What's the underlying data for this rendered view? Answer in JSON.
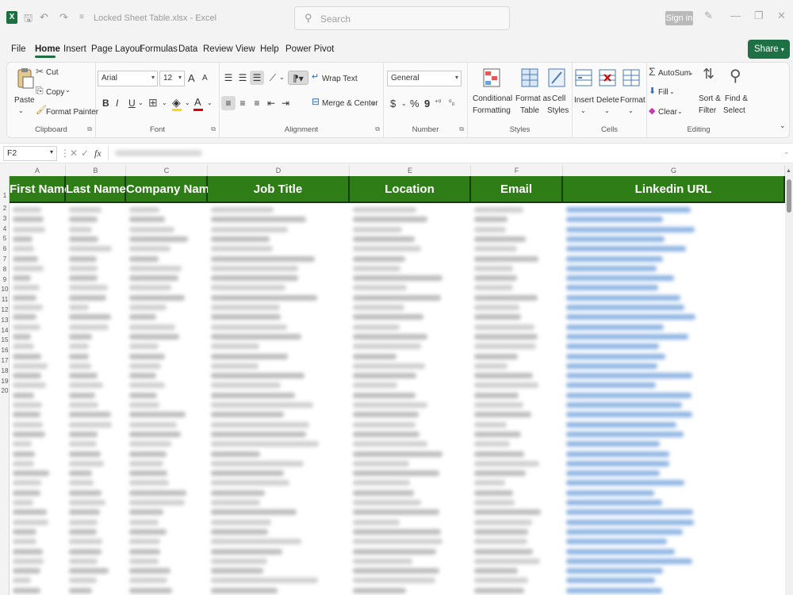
{
  "titlebar": {
    "app_badge": "X",
    "title": "Locked Sheet Table.xlsx  -  Excel",
    "search_placeholder": "Search",
    "signin": "Sign in"
  },
  "menu": {
    "tabs": [
      "File",
      "Home",
      "Insert",
      "Page Layout",
      "Formulas",
      "Data",
      "Review",
      "View",
      "Help",
      "Power Pivot"
    ],
    "active": "Home",
    "share": "Share"
  },
  "ribbon": {
    "clipboard": {
      "label": "Clipboard",
      "paste": "Paste",
      "cut": "Cut",
      "copy": "Copy",
      "format_painter": "Format Painter"
    },
    "font": {
      "label": "Font",
      "font_name": "Arial",
      "font_size": "12",
      "grow": "A",
      "shrink": "A",
      "bold": "B",
      "italic": "I",
      "underline": "U",
      "font_color": "A"
    },
    "alignment": {
      "label": "Alignment",
      "wrap_text": "Wrap Text",
      "merge_center": "Merge & Center"
    },
    "number": {
      "label": "Number",
      "format": "General",
      "currency": "$",
      "percent": "%",
      "comma": "9"
    },
    "styles": {
      "label": "Styles",
      "conditional_1": "Conditional",
      "conditional_2": "Formatting",
      "format_table_1": "Format as",
      "format_table_2": "Table",
      "cell_styles_1": "Cell",
      "cell_styles_2": "Styles"
    },
    "cells": {
      "label": "Cells",
      "insert": "Insert",
      "delete": "Delete",
      "format": "Format"
    },
    "editing": {
      "label": "Editing",
      "autosum": "AutoSum",
      "fill": "Fill",
      "clear": "Clear",
      "sort_1": "Sort &",
      "sort_2": "Filter",
      "find_1": "Find &",
      "find_2": "Select"
    }
  },
  "formula_bar": {
    "name_box": "F2",
    "fx": "fx"
  },
  "grid": {
    "columns": [
      "A",
      "B",
      "C",
      "D",
      "E",
      "F",
      "G"
    ],
    "headers": [
      "First Name",
      "Last Name",
      "Company Name",
      "Job Title",
      "Location",
      "Email",
      "Linkedin URL"
    ],
    "header_bg": "#2e7d16",
    "link_color": "#8fb4e3",
    "row_numbers": [
      "1",
      "2",
      "3",
      "4",
      "5",
      "6",
      "7",
      "8",
      "9",
      "10",
      "11",
      "12",
      "13",
      "14",
      "15",
      "16",
      "17",
      "18",
      "19",
      "20"
    ]
  }
}
